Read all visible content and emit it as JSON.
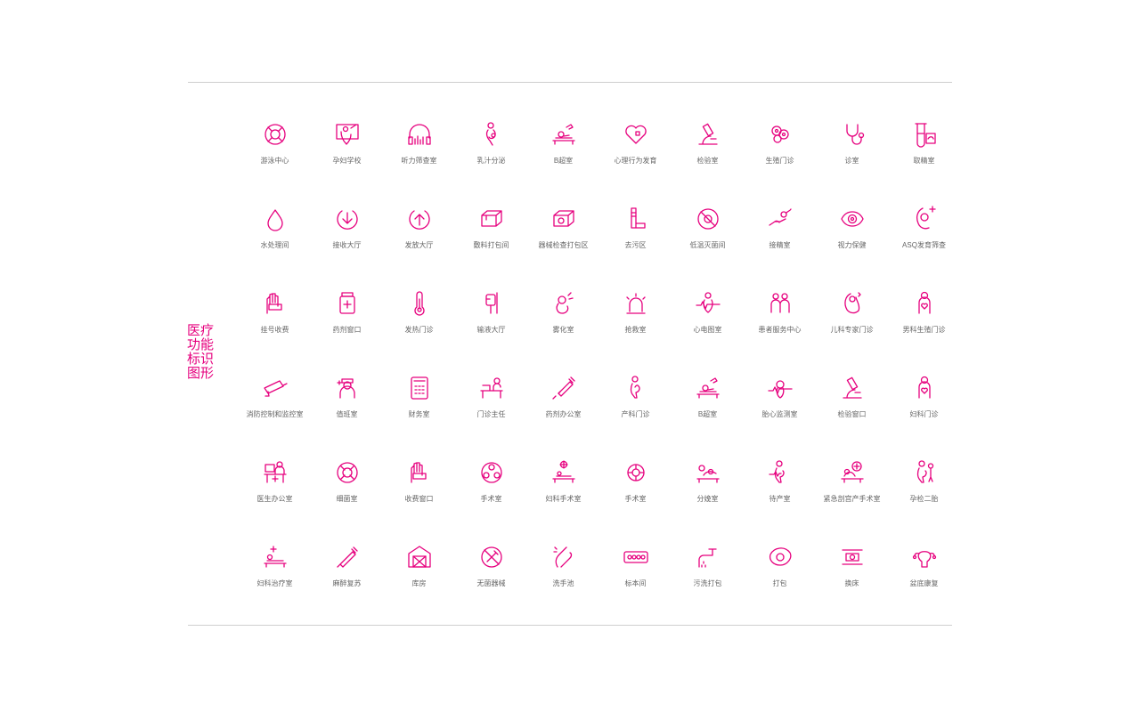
{
  "title": [
    "医疗",
    "功能",
    "标识",
    "图形"
  ],
  "colors": {
    "accent": "#e6007e",
    "label": "#666666",
    "rule": "#cfcfcf"
  },
  "icons": [
    {
      "label": "游泳中心",
      "icon": "lifebuoy"
    },
    {
      "label": "孕妇学校",
      "icon": "pregnant-board"
    },
    {
      "label": "听力筛查室",
      "icon": "headphones"
    },
    {
      "label": "乳汁分泌",
      "icon": "breastfeeding"
    },
    {
      "label": "B超室",
      "icon": "ultrasound-bed"
    },
    {
      "label": "心理行为发育",
      "icon": "heart-puzzle"
    },
    {
      "label": "检验室",
      "icon": "microscope"
    },
    {
      "label": "生殖门诊",
      "icon": "cells"
    },
    {
      "label": "诊室",
      "icon": "stethoscope"
    },
    {
      "label": "取精室",
      "icon": "test-tube"
    },
    {
      "label": "水处理间",
      "icon": "water-drop"
    },
    {
      "label": "接收大厅",
      "icon": "arrow-down-circle"
    },
    {
      "label": "发放大厅",
      "icon": "arrow-up-circle"
    },
    {
      "label": "敷料打包间",
      "icon": "package"
    },
    {
      "label": "器械检查打包区",
      "icon": "package-gear"
    },
    {
      "label": "去污区",
      "icon": "brush"
    },
    {
      "label": "低温灭菌间",
      "icon": "no-bacteria"
    },
    {
      "label": "接精室",
      "icon": "hand-sperm"
    },
    {
      "label": "视力保健",
      "icon": "eye"
    },
    {
      "label": "ASQ发育筛查",
      "icon": "baby-check"
    },
    {
      "label": "挂号收费",
      "icon": "hand-card"
    },
    {
      "label": "药剂窗口",
      "icon": "medicine-bottle"
    },
    {
      "label": "发热门诊",
      "icon": "thermometer"
    },
    {
      "label": "输液大厅",
      "icon": "iv-bag"
    },
    {
      "label": "雾化室",
      "icon": "nebulizer"
    },
    {
      "label": "抢救室",
      "icon": "alarm-light"
    },
    {
      "label": "心电图室",
      "icon": "ecg-person"
    },
    {
      "label": "患者服务中心",
      "icon": "two-people"
    },
    {
      "label": "儿科专家门诊",
      "icon": "swaddled-baby"
    },
    {
      "label": "男科生殖门诊",
      "icon": "man-heart"
    },
    {
      "label": "消防控制和监控室",
      "icon": "cctv-camera"
    },
    {
      "label": "值班室",
      "icon": "nurse"
    },
    {
      "label": "财务室",
      "icon": "calculator"
    },
    {
      "label": "门诊主任",
      "icon": "desk-person"
    },
    {
      "label": "药剂办公室",
      "icon": "syringe"
    },
    {
      "label": "产科门诊",
      "icon": "pregnant"
    },
    {
      "label": "B超室",
      "icon": "ultrasound-bed"
    },
    {
      "label": "胎心监测室",
      "icon": "fetal-monitor"
    },
    {
      "label": "检验窗口",
      "icon": "microscope"
    },
    {
      "label": "妇科门诊",
      "icon": "woman-heart"
    },
    {
      "label": "医生办公室",
      "icon": "doctor-desk"
    },
    {
      "label": "细菌室",
      "icon": "bacteria"
    },
    {
      "label": "收费窗口",
      "icon": "hand-card"
    },
    {
      "label": "手术室",
      "icon": "surgical-light"
    },
    {
      "label": "妇科手术室",
      "icon": "surgery-bed"
    },
    {
      "label": "手术室",
      "icon": "surgical-light-small"
    },
    {
      "label": "分娩室",
      "icon": "delivery"
    },
    {
      "label": "待产室",
      "icon": "waiting-pregnant"
    },
    {
      "label": "紧急剖宫产手术室",
      "icon": "emergency-cesarean"
    },
    {
      "label": "孕检二胎",
      "icon": "second-child"
    },
    {
      "label": "妇科治疗室",
      "icon": "treatment-bed"
    },
    {
      "label": "麻醉复苏",
      "icon": "syringe-diagonal"
    },
    {
      "label": "库房",
      "icon": "warehouse"
    },
    {
      "label": "无菌器械",
      "icon": "no-instrument"
    },
    {
      "label": "洗手池",
      "icon": "hand-wash"
    },
    {
      "label": "标本间",
      "icon": "specimen-tray"
    },
    {
      "label": "污洗打包",
      "icon": "faucet"
    },
    {
      "label": "打包",
      "icon": "wrap-package"
    },
    {
      "label": "换床",
      "icon": "bed-swap"
    },
    {
      "label": "盆底康复",
      "icon": "uterus"
    }
  ]
}
